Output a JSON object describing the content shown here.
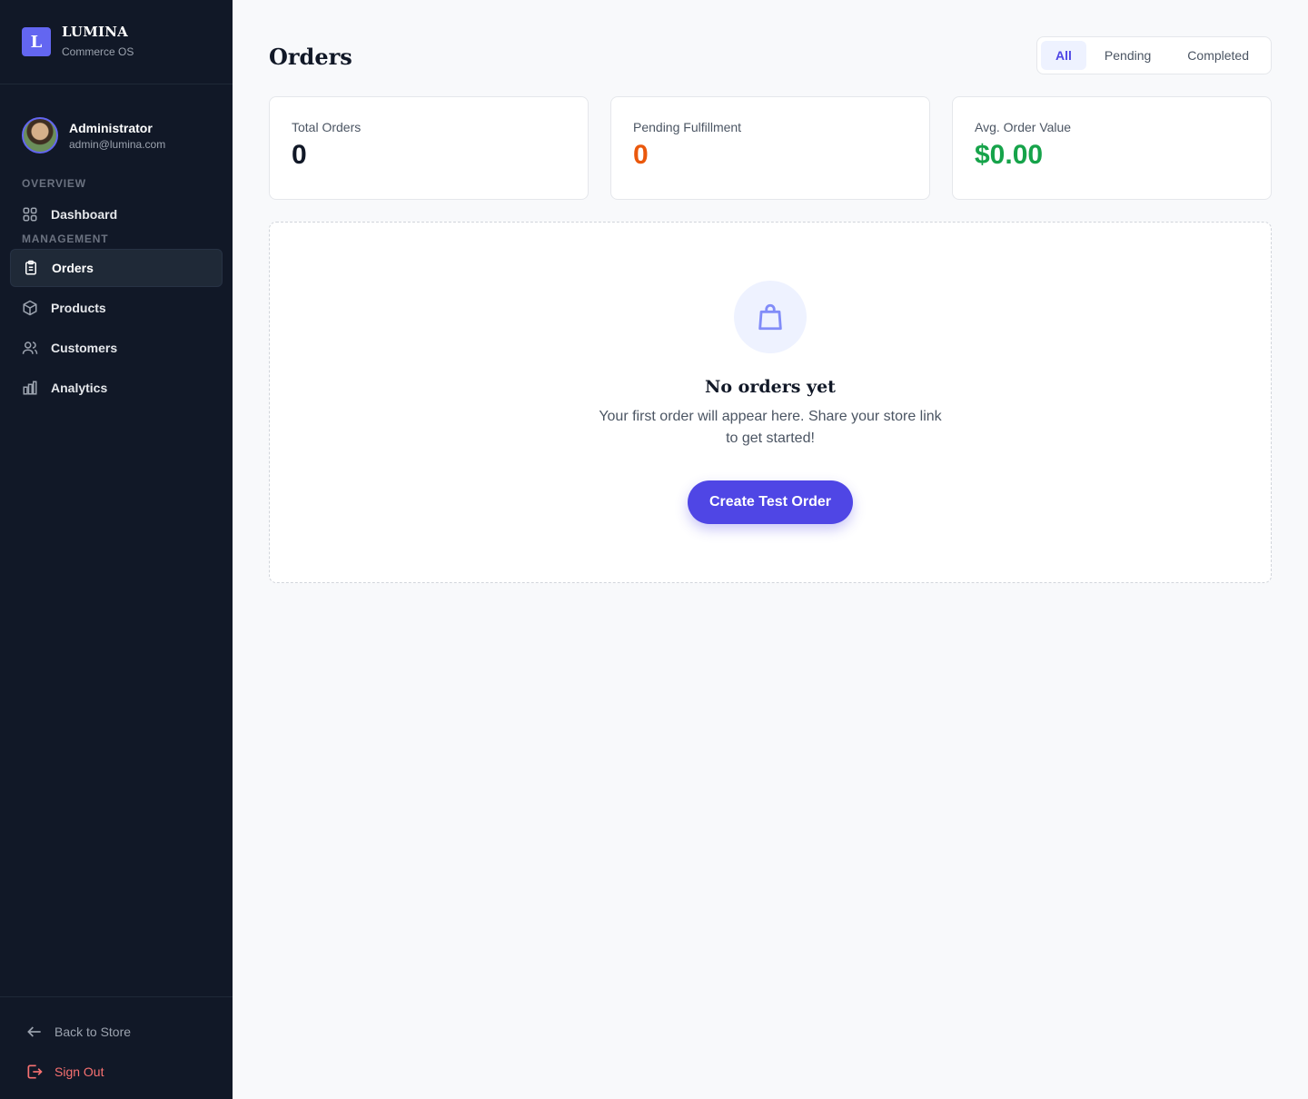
{
  "brand": {
    "logo_letter": "L",
    "name": "LUMINA",
    "subtitle": "Commerce OS"
  },
  "user": {
    "name": "Administrator",
    "email": "admin@lumina.com"
  },
  "nav": {
    "overview_label": "OVERVIEW",
    "management_label": "MANAGEMENT",
    "items": [
      {
        "label": "Dashboard",
        "icon": "grid-icon"
      },
      {
        "label": "Orders",
        "icon": "clipboard-icon",
        "active": true
      },
      {
        "label": "Products",
        "icon": "box-icon"
      },
      {
        "label": "Customers",
        "icon": "users-icon"
      },
      {
        "label": "Analytics",
        "icon": "bar-chart-icon"
      }
    ]
  },
  "footer": {
    "back_label": "Back to Store",
    "signout_label": "Sign Out"
  },
  "main": {
    "title": "Orders",
    "tabs": [
      "All",
      "Pending",
      "Completed"
    ],
    "active_tab": "All",
    "stats": [
      {
        "label": "Total Orders",
        "value": "0",
        "color": "#111827"
      },
      {
        "label": "Pending Fulfillment",
        "value": "0",
        "color": "#ea580c"
      },
      {
        "label": "Avg. Order Value",
        "value": "$0.00",
        "color": "#16a34a"
      }
    ],
    "empty": {
      "icon": "shopping-bag-icon",
      "title": "No orders yet",
      "text": "Your first order will appear here. Share your store link to get started!",
      "button_label": "Create Test Order"
    }
  },
  "colors": {
    "accent": "#4f46e5",
    "sidebar_bg": "#111827",
    "danger": "#f87171"
  }
}
